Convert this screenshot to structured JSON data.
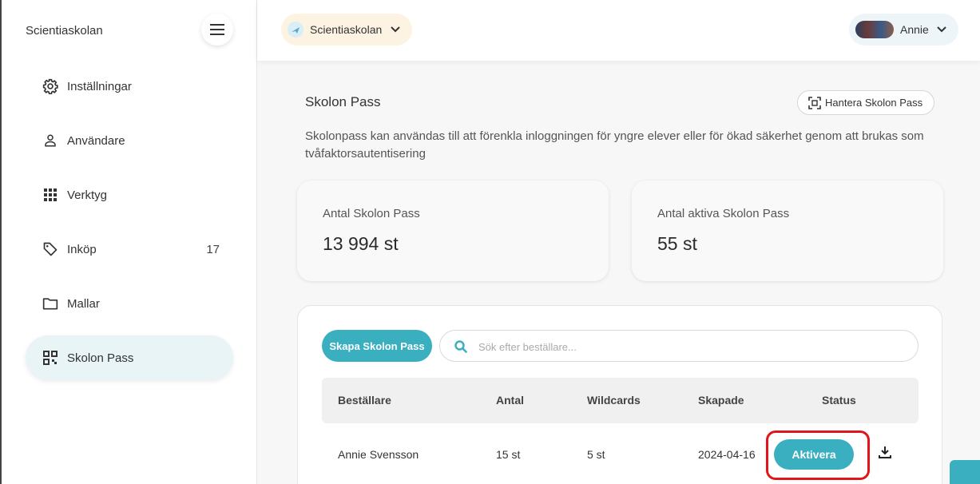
{
  "sidebar": {
    "brand": "Scientiaskolan",
    "items": [
      {
        "label": "Inställningar",
        "icon": "gear-icon"
      },
      {
        "label": "Användare",
        "icon": "person-icon"
      },
      {
        "label": "Verktyg",
        "icon": "grid-icon"
      },
      {
        "label": "Inköp",
        "icon": "tag-icon",
        "count": "17"
      },
      {
        "label": "Mallar",
        "icon": "folder-icon"
      },
      {
        "label": "Skolon Pass",
        "icon": "qr-code-icon",
        "active": true
      }
    ]
  },
  "topbar": {
    "org_name": "Scientiaskolan",
    "user_name": "Annie"
  },
  "main": {
    "title": "Skolon Pass",
    "manage_label": "Hantera Skolon Pass",
    "description": "Skolonpass kan användas till att förenkla inloggningen för yngre elever eller för ökad säkerhet genom att brukas som tvåfaktorsautentisering",
    "stats": [
      {
        "title": "Antal Skolon Pass",
        "value": "13 994 st"
      },
      {
        "title": "Antal aktiva Skolon Pass",
        "value": "55 st"
      }
    ],
    "create_label": "Skapa Skolon Pass",
    "search_placeholder": "Sök efter beställare...",
    "table": {
      "headers": [
        "Beställare",
        "Antal",
        "Wildcards",
        "Skapade",
        "Status"
      ],
      "rows": [
        {
          "orderer": "Annie Svensson",
          "count": "15 st",
          "wildcards": "5 st",
          "created": "2024-04-16",
          "action": "Aktivera"
        }
      ]
    }
  },
  "colors": {
    "accent": "#3aafbf",
    "highlight": "#e0161c",
    "active_nav_bg": "#e9f4f6"
  }
}
